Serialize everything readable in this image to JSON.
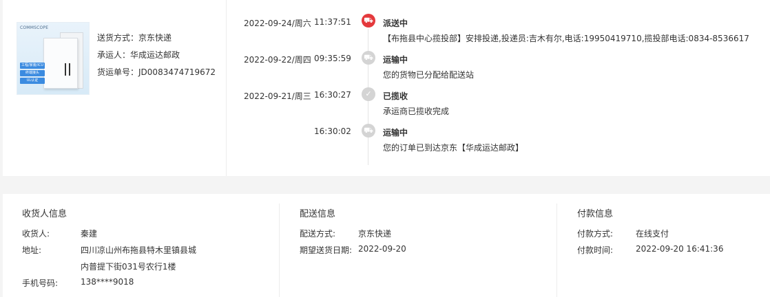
{
  "shipment": {
    "image_alt": "product",
    "thumb_brand": "COMMSCOPE",
    "thumb_tags": [
      "工程/家装/ICU",
      "终端接头",
      "UL认证"
    ],
    "method_label": "送货方式：",
    "method_value": "京东快递",
    "carrier_label": "承运人：",
    "carrier_value": "华成运达邮政",
    "tracking_label": "货运单号：",
    "tracking_value": "JD0083474719672"
  },
  "timeline": [
    {
      "date": "2022-09-24/周六",
      "time": "11:37:51",
      "status": "派送中",
      "desc": "【布拖县中心揽投部】安排投递,投递员:吉木有尔,电话:19950419710,揽投部电话:0834-8536617",
      "icon": "delivery-truck-icon",
      "active": true
    },
    {
      "date": "2022-09-22/周四",
      "time": "09:35:59",
      "status": "运输中",
      "desc": "您的货物已分配给配送站",
      "icon": "transit-truck-icon",
      "active": false
    },
    {
      "date": "2022-09-21/周三",
      "time": "16:30:27",
      "status": "已揽收",
      "desc": "承运商已揽收完成",
      "icon": "pickup-icon",
      "active": false
    },
    {
      "date": "",
      "time": "16:30:02",
      "status": "运输中",
      "desc": "您的订单已到达京东【华成运达邮政】",
      "icon": "transit-truck-icon",
      "active": false
    }
  ],
  "consignee": {
    "title": "收货人信息",
    "name_label": "收货人:",
    "name_value": "秦建",
    "address_label": "地址:",
    "address_line1": "四川凉山州布拖县特木里镇县城",
    "address_line2": "内普提下街031号农行1楼",
    "phone_label": "手机号码:",
    "phone_value": "138****9018"
  },
  "delivery": {
    "title": "配送信息",
    "method_label": "配送方式:",
    "method_value": "京东快递",
    "expected_label": "期望送货日期:",
    "expected_value": "2022-09-20"
  },
  "payment": {
    "title": "付款信息",
    "method_label": "付款方式:",
    "method_value": "在线支付",
    "time_label": "付款时间:",
    "time_value": "2022-09-20 16:41:36"
  },
  "colors": {
    "accent": "#e4393c",
    "inactive_dot": "#d4d4d4",
    "background": "#f4f4f4"
  }
}
